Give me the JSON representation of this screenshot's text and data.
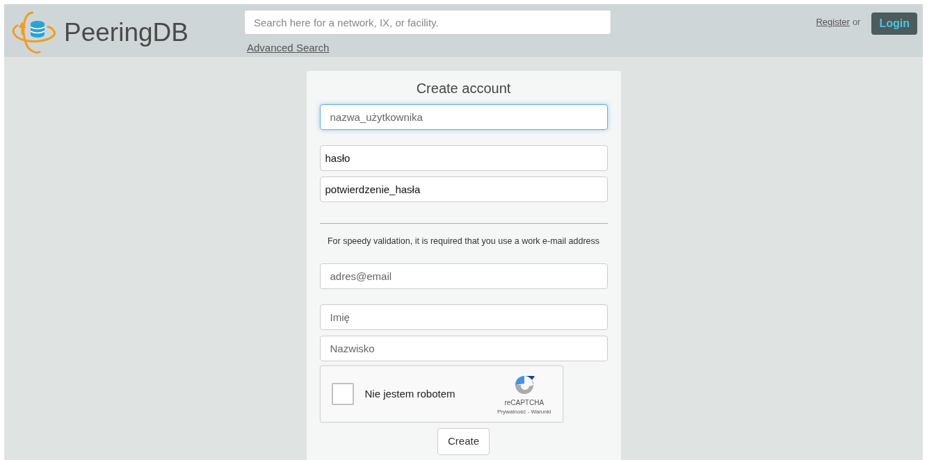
{
  "header": {
    "brand": "PeeringDB",
    "search": {
      "placeholder": "Search here for a network, IX, or facility."
    },
    "advanced_search": "Advanced Search",
    "register": "Register",
    "or": "or",
    "login": "Login"
  },
  "form": {
    "title": "Create account",
    "groups": [
      [
        {
          "kind": "text",
          "placeholder": "nazwa_użytkownika",
          "focused": true
        }
      ],
      [
        {
          "kind": "password",
          "placeholder": "hasło",
          "focused": false
        },
        {
          "kind": "password",
          "placeholder": "potwierdzenie_hasła",
          "focused": false
        }
      ],
      [
        {
          "kind": "note",
          "text": "For speedy validation, it is required that you use a work e-mail address"
        },
        {
          "kind": "text",
          "placeholder": "adres@email",
          "focused": false
        }
      ],
      [
        {
          "kind": "text",
          "placeholder": "Imię",
          "focused": false
        },
        {
          "kind": "text",
          "placeholder": "Nazwisko",
          "focused": false
        }
      ]
    ],
    "captcha": {
      "label": "Nie jestem robotem",
      "checked": false,
      "brand": "reCAPTCHA",
      "links": "Prywatność - Warunki"
    },
    "submit": "Create"
  }
}
